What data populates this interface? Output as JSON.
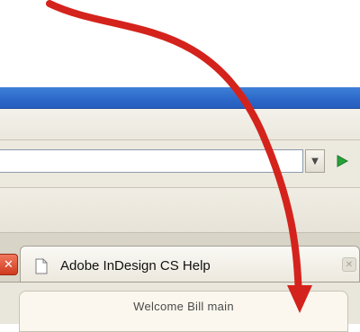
{
  "browser": {
    "tab": {
      "label": "Adobe InDesign CS Help",
      "icon": "page-icon"
    },
    "address_bar": {
      "dropdown_icon": "chevron-down-icon",
      "go_icon": "play-icon",
      "go_color": "#27a23a"
    },
    "close_icon": "close-icon",
    "accent_color": "#2c68c8"
  },
  "content": {
    "welcome": "Welcome Bill main"
  },
  "annotation": {
    "arrow_color": "#d4231c",
    "icon": "curved-arrow-icon"
  }
}
